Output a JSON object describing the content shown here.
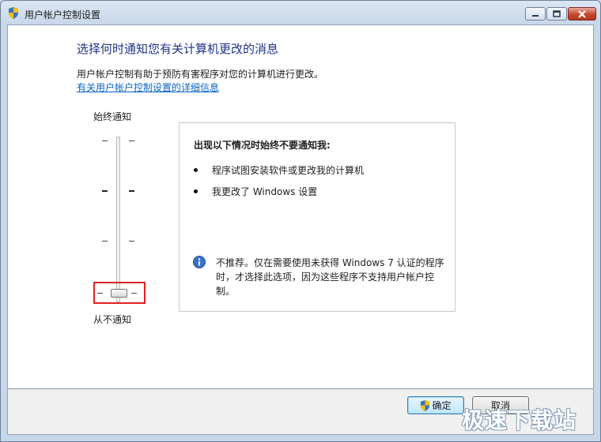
{
  "window": {
    "title": "用户帐户控制设置",
    "icons": {
      "title_icon": "uac-shield-icon",
      "minimize": "minimize-icon",
      "maximize": "maximize-icon",
      "close": "close-icon"
    }
  },
  "main": {
    "heading": "选择何时通知您有关计算机更改的消息",
    "description": "用户帐户控制有助于预防有害程序对您的计算机进行更改。",
    "details_link": "有关用户帐户控制设置的详细信息"
  },
  "slider": {
    "top_label": "始终通知",
    "bottom_label": "从不通知",
    "levels": 4,
    "selected_level": 4
  },
  "panel": {
    "heading": "出现以下情况时始终不要通知我:",
    "bullets": [
      "程序试图安装软件或更改我的计算机",
      "我更改了 Windows 设置"
    ],
    "note": "不推荐。仅在需要使用未获得 Windows 7 认证的程序时，才选择此选项，因为这些程序不支持用户帐户控制。",
    "note_icon": "info-icon"
  },
  "footer": {
    "ok_label": "确定",
    "cancel_label": "取消",
    "ok_icon": "uac-shield-icon"
  },
  "watermark": "极速下载站",
  "colors": {
    "heading": "#1e3287",
    "link": "#0b63c0",
    "highlight": "#e02020"
  }
}
